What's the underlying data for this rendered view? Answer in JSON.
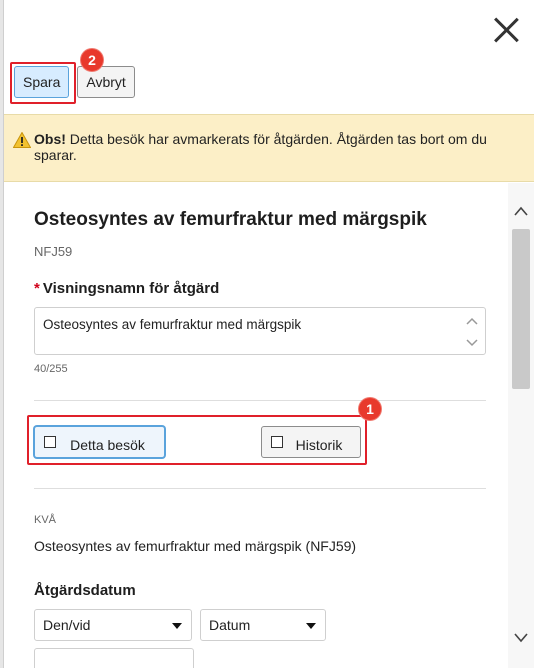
{
  "toolbar": {
    "save_label": "Spara",
    "cancel_label": "Avbryt"
  },
  "annotations": {
    "badge_1": "1",
    "badge_2": "2",
    "highlight_color": "#e0202a"
  },
  "warning": {
    "strong": "Obs!",
    "text": " Detta besök har avmarkerats för åtgärden. Åtgärden tas bort om du sparar.",
    "background": "#fcefc7"
  },
  "procedure": {
    "title": "Osteosyntes av femurfraktur med märgspik",
    "code": "NFJ59"
  },
  "display_name": {
    "required_mark": "*",
    "label": "Visningsnamn för åtgärd",
    "value": "Osteosyntes av femurfraktur med märgspik",
    "counter": "40/255"
  },
  "toggles": {
    "this_visit": "Detta besök",
    "history": "Historik"
  },
  "kva": {
    "label": "KVÅ",
    "value": "Osteosyntes av femurfraktur med märgspik (NFJ59)"
  },
  "procedure_date": {
    "label": "Åtgärdsdatum",
    "qualifier_select": "Den/vid",
    "type_select": "Datum"
  },
  "icons": {
    "close": "close-icon",
    "warning": "warning-icon",
    "scroll_up": "chevron-up-icon",
    "scroll_down": "chevron-down-icon"
  }
}
